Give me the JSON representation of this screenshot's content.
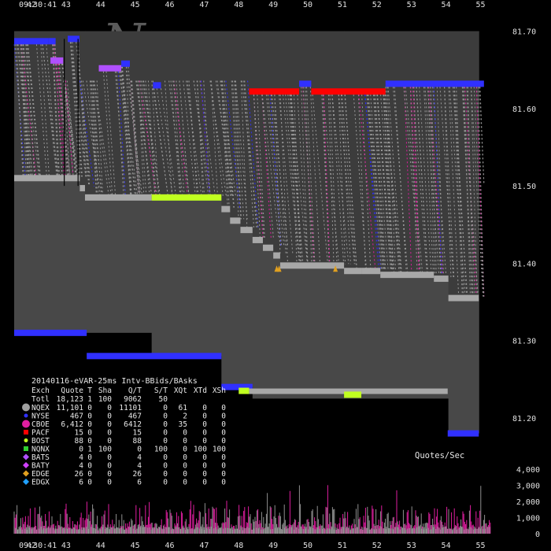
{
  "chart_data": {
    "type": "line",
    "title": "20140116-eVAR-25ms Intv-BBids/BAsks",
    "time_start_label": "09:30:41",
    "time_end_label": "09:30:41",
    "x_ticks": [
      "42",
      "43",
      "44",
      "45",
      "46",
      "47",
      "48",
      "49",
      "50",
      "51",
      "52",
      "53",
      "54",
      "55"
    ],
    "price_ticks": [
      "81.70",
      "81.60",
      "81.50",
      "81.40",
      "81.30",
      "81.20"
    ],
    "price_values": [
      81.7,
      81.6,
      81.5,
      81.4,
      81.3,
      81.2
    ],
    "ylim": [
      81.145,
      81.725
    ],
    "xlim": [
      41.5,
      55.4
    ],
    "watermark": "Nanex",
    "best_ask_segments": [
      {
        "x0": 41.5,
        "x1": 42.5,
        "price": 81.687,
        "exch": "NYSE"
      },
      {
        "x0": 42.5,
        "x1": 42.7,
        "price": 81.687,
        "exch": "NYSE"
      },
      {
        "x0": 42.55,
        "x1": 42.92,
        "price": 81.662,
        "exch": "BATS"
      },
      {
        "x0": 43.05,
        "x1": 43.39,
        "price": 81.69,
        "exch": "NYSE"
      },
      {
        "x0": 43.95,
        "x1": 44.6,
        "price": 81.652,
        "exch": "BATS"
      },
      {
        "x0": 44.6,
        "x1": 44.85,
        "price": 81.658,
        "exch": "NYSE"
      },
      {
        "x0": 45.52,
        "x1": 45.75,
        "price": 81.63,
        "exch": "NYSE"
      },
      {
        "x0": 48.3,
        "x1": 49.75,
        "price": 81.622,
        "exch": "PACF"
      },
      {
        "x0": 49.75,
        "x1": 50.1,
        "price": 81.632,
        "exch": "NYSE"
      },
      {
        "x0": 50.1,
        "x1": 52.25,
        "price": 81.622,
        "exch": "PACF"
      },
      {
        "x0": 52.25,
        "x1": 55.1,
        "price": 81.632,
        "exch": "NYSE"
      }
    ],
    "best_bid_segments": [
      {
        "x0": 41.5,
        "x1": 43.6,
        "price": 81.31,
        "exch": "NYSE"
      },
      {
        "x0": 43.6,
        "x1": 47.5,
        "price": 81.28,
        "exch": "NYSE"
      },
      {
        "x0": 47.5,
        "x1": 48.4,
        "price": 81.24,
        "exch": "NYSE"
      },
      {
        "x0": 54.05,
        "x1": 54.95,
        "price": 81.18,
        "exch": "NYSE"
      }
    ],
    "nbbo_bid_steps": [
      {
        "x0": 41.5,
        "x1": 43.4,
        "price": 81.51
      },
      {
        "x0": 43.4,
        "x1": 43.55,
        "price": 81.497
      },
      {
        "x0": 43.55,
        "x1": 45.48,
        "price": 81.485
      },
      {
        "x0": 45.48,
        "x1": 47.5,
        "price": 81.485,
        "exch": "NQNX"
      },
      {
        "x0": 47.5,
        "x1": 47.75,
        "price": 81.47
      },
      {
        "x0": 47.75,
        "x1": 48.05,
        "price": 81.455
      },
      {
        "x0": 48.05,
        "x1": 48.4,
        "price": 81.443
      },
      {
        "x0": 48.4,
        "x1": 48.7,
        "price": 81.43
      },
      {
        "x0": 48.7,
        "x1": 49.0,
        "price": 81.42
      },
      {
        "x0": 49.0,
        "x1": 49.2,
        "price": 81.41
      },
      {
        "x0": 49.2,
        "x1": 51.05,
        "price": 81.397
      },
      {
        "x0": 51.05,
        "x1": 51.55,
        "price": 81.39
      },
      {
        "x0": 51.55,
        "x1": 52.1,
        "price": 81.39
      },
      {
        "x0": 52.1,
        "x1": 53.65,
        "price": 81.385
      },
      {
        "x0": 53.65,
        "x1": 54.07,
        "price": 81.38
      },
      {
        "x0": 54.07,
        "x1": 54.95,
        "price": 81.355
      }
    ],
    "ask_price_at_x": [
      [
        41.5,
        81.68
      ],
      [
        42.0,
        81.68
      ],
      [
        42.5,
        81.665
      ],
      [
        43.0,
        81.69
      ],
      [
        43.4,
        81.68
      ],
      [
        43.6,
        81.652
      ],
      [
        45.5,
        81.652
      ],
      [
        45.55,
        81.63
      ],
      [
        46.0,
        81.63
      ],
      [
        47.5,
        81.63
      ],
      [
        48.3,
        81.622
      ],
      [
        55.1,
        81.632
      ]
    ],
    "x_anomaly_markers": [
      {
        "x": 49.1,
        "price": 81.392,
        "exch": "EDGE"
      },
      {
        "x": 49.17,
        "price": 81.392,
        "exch": "EDGE"
      },
      {
        "x": 50.8,
        "price": 81.392,
        "exch": "EDGE"
      }
    ],
    "low_bid_flicker": [
      {
        "x0": 48.0,
        "x1": 48.3,
        "price": 81.235,
        "exch": "NQNX"
      },
      {
        "x0": 51.05,
        "x1": 51.55,
        "price": 81.23,
        "exch": "NQNX"
      }
    ],
    "legend": {
      "title": "20140116-eVAR-25ms Intv-BBids/BAsks",
      "header": [
        "Exch",
        "Quote",
        "T",
        "Sha",
        "Q/T",
        "S/T",
        "XQt",
        "XTd",
        "XSh"
      ],
      "total_row": [
        "Totl",
        "18,123",
        "1",
        "100",
        "9062",
        "50",
        "",
        "",
        ""
      ],
      "rows": [
        {
          "exch": "NQEX",
          "quote": "11,101",
          "t": "0",
          "sha": "0",
          "qt": "11101",
          "st": "0",
          "xqt": "61",
          "xtd": "0",
          "xsh": "0",
          "color": "#a0a0a0",
          "marker": "big-circle"
        },
        {
          "exch": "NYSE",
          "quote": "467",
          "t": "0",
          "sha": "0",
          "qt": "467",
          "st": "0",
          "xqt": "2",
          "xtd": "0",
          "xsh": "0",
          "color": "#3030ff",
          "marker": "dot"
        },
        {
          "exch": "CBOE",
          "quote": "6,412",
          "t": "0",
          "sha": "0",
          "qt": "6412",
          "st": "0",
          "xqt": "35",
          "xtd": "0",
          "xsh": "0",
          "color": "#e01ea0",
          "marker": "big-circle"
        },
        {
          "exch": "PACF",
          "quote": "15",
          "t": "0",
          "sha": "0",
          "qt": "15",
          "st": "0",
          "xqt": "0",
          "xtd": "0",
          "xsh": "0",
          "color": "#ff0000",
          "marker": "square"
        },
        {
          "exch": "BOST",
          "quote": "88",
          "t": "0",
          "sha": "0",
          "qt": "88",
          "st": "0",
          "xqt": "0",
          "xtd": "0",
          "xsh": "0",
          "color": "#c0ff20",
          "marker": "dot"
        },
        {
          "exch": "NQNX",
          "quote": "0",
          "t": "1",
          "sha": "100",
          "qt": "0",
          "st": "100",
          "xqt": "0",
          "xtd": "100",
          "xsh": "100",
          "color": "#30d030",
          "marker": "square"
        },
        {
          "exch": "BATS",
          "quote": "4",
          "t": "0",
          "sha": "0",
          "qt": "4",
          "st": "0",
          "xqt": "0",
          "xtd": "0",
          "xsh": "0",
          "color": "#b050ff",
          "marker": "diamond"
        },
        {
          "exch": "BATY",
          "quote": "4",
          "t": "0",
          "sha": "0",
          "qt": "4",
          "st": "0",
          "xqt": "0",
          "xtd": "0",
          "xsh": "0",
          "color": "#d040ff",
          "marker": "diamond"
        },
        {
          "exch": "EDGE",
          "quote": "26",
          "t": "0",
          "sha": "0",
          "qt": "26",
          "st": "0",
          "xqt": "0",
          "xtd": "0",
          "xsh": "0",
          "color": "#e0a020",
          "marker": "diamond"
        },
        {
          "exch": "EDGX",
          "quote": "6",
          "t": "0",
          "sha": "0",
          "qt": "6",
          "st": "0",
          "xqt": "0",
          "xtd": "0",
          "xsh": "0",
          "color": "#20a0ff",
          "marker": "diamond"
        }
      ]
    },
    "quotes_per_sec": {
      "label": "Quotes/Sec",
      "ticks": [
        "4,000",
        "3,000",
        "2,000",
        "1,000",
        "0"
      ],
      "tick_values": [
        4000,
        3000,
        2000,
        1000,
        0
      ],
      "ylim": [
        0,
        4300
      ],
      "baseline_level": 400,
      "typical_peak": 1500,
      "max_peak": 3200
    },
    "colors": {
      "background": "#000000",
      "fill_gray": "#484848",
      "bid_line": "#a8a8a8",
      "nyse": "#3030ff",
      "cboe": "#e01ea0",
      "pacf": "#ff0000",
      "bost": "#c0ff20",
      "bats": "#b050ff",
      "edge": "#e0a020",
      "axis_text": "#e0e0e0",
      "watermark": "#5a5a5a"
    }
  }
}
